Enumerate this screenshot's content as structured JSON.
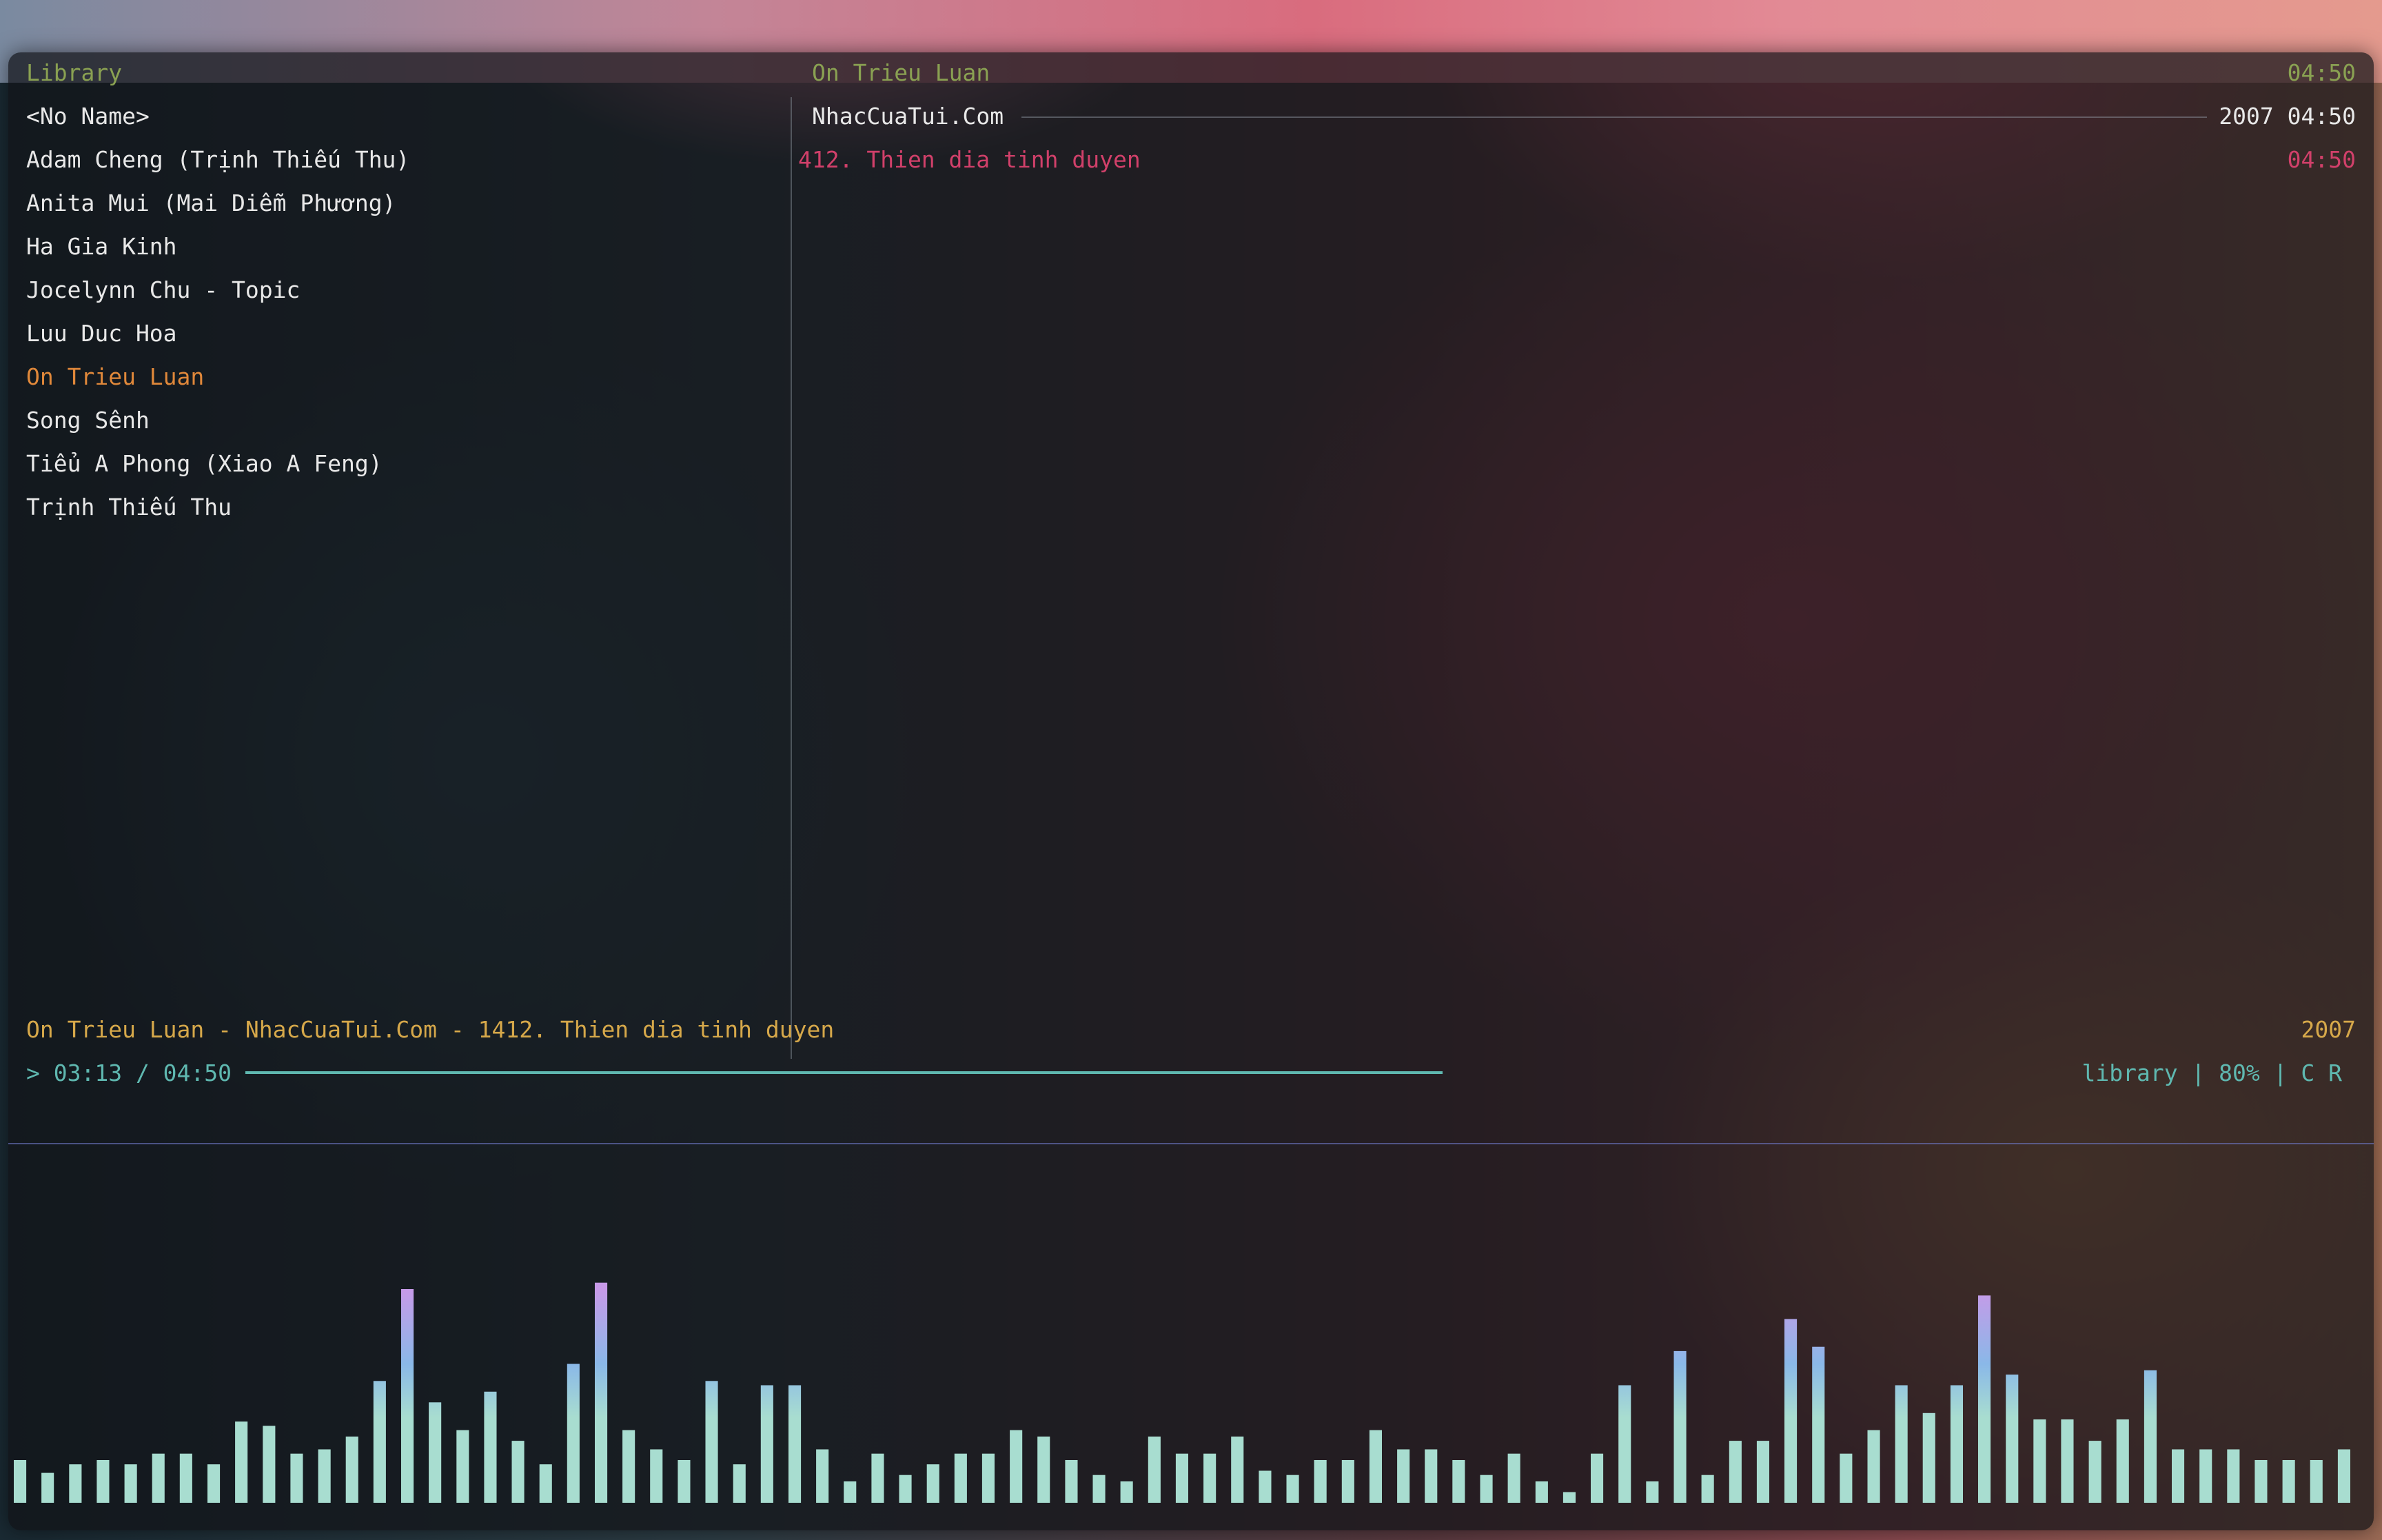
{
  "library": {
    "title": "Library",
    "items": [
      "<No Name>",
      "Adam Cheng (Trịnh Thiếu Thu)",
      "Anita Mui (Mai Diễm Phương)",
      "Ha Gia Kinh",
      "Jocelynn Chu - Topic",
      "Luu Duc Hoa",
      "On Trieu Luan",
      "Song Sênh",
      "Tiểu A Phong (Xiao A Feng)",
      "Trịnh Thiếu Thu"
    ],
    "selected_index": 6
  },
  "album_pane": {
    "artist": "On Trieu Luan",
    "artist_duration": "04:50",
    "album": "NhacCuaTui.Com",
    "album_meta": "2007 04:50",
    "tracks": [
      {
        "title": "412. Thien dia tinh duyen",
        "duration": "04:50"
      }
    ]
  },
  "status": {
    "now_playing": "On Trieu Luan - NhacCuaTui.Com - 1412. Thien dia tinh duyen",
    "year": "2007",
    "playback": "> 03:13 / 04:50",
    "progress": 0.66,
    "right_info": "library | 80% | C R"
  },
  "colors": {
    "header": "#8aa152",
    "selected": "#e0883a",
    "now_playing": "#d6a84a",
    "current_track": "#d1406a",
    "status": "#5fb8b0",
    "bar_bottom": "#a8ddd0",
    "bar_mid": "#8ab8e8",
    "bar_top": "#c79ae8"
  },
  "visualizer": {
    "levels": [
      0.2,
      0.14,
      0.18,
      0.2,
      0.18,
      0.23,
      0.23,
      0.18,
      0.38,
      0.36,
      0.23,
      0.25,
      0.31,
      0.57,
      1.0,
      0.47,
      0.34,
      0.52,
      0.29,
      0.18,
      0.65,
      1.03,
      0.34,
      0.25,
      0.2,
      0.57,
      0.18,
      0.55,
      0.55,
      0.25,
      0.1,
      0.23,
      0.13,
      0.18,
      0.23,
      0.23,
      0.34,
      0.31,
      0.2,
      0.13,
      0.1,
      0.31,
      0.23,
      0.23,
      0.31,
      0.15,
      0.13,
      0.2,
      0.2,
      0.34,
      0.25,
      0.25,
      0.2,
      0.13,
      0.23,
      0.1,
      0.05,
      0.23,
      0.55,
      0.1,
      0.71,
      0.13,
      0.29,
      0.29,
      0.86,
      0.73,
      0.23,
      0.34,
      0.55,
      0.42,
      0.55,
      0.97,
      0.6,
      0.39,
      0.39,
      0.29,
      0.39,
      0.62,
      0.25,
      0.25,
      0.25,
      0.2,
      0.2,
      0.2,
      0.25
    ]
  }
}
